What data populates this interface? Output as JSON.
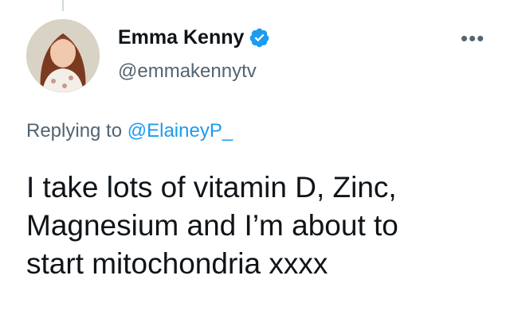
{
  "author": {
    "display_name": "Emma Kenny",
    "handle": "@emmakennytv",
    "verified": true
  },
  "more_menu": {
    "label": "•••"
  },
  "reply": {
    "prefix": "Replying to ",
    "mention": "@ElaineyP_"
  },
  "tweet": {
    "text_lines": [
      "I take lots of vitamin D, Zinc,",
      "Magnesium and I’m about to",
      "start mitochondria xxxx"
    ]
  },
  "colors": {
    "text": "#0f1419",
    "secondary": "#536471",
    "accent": "#1d9bf0"
  },
  "icons": {
    "verified": "verified-badge-icon",
    "more": "more-icon"
  }
}
